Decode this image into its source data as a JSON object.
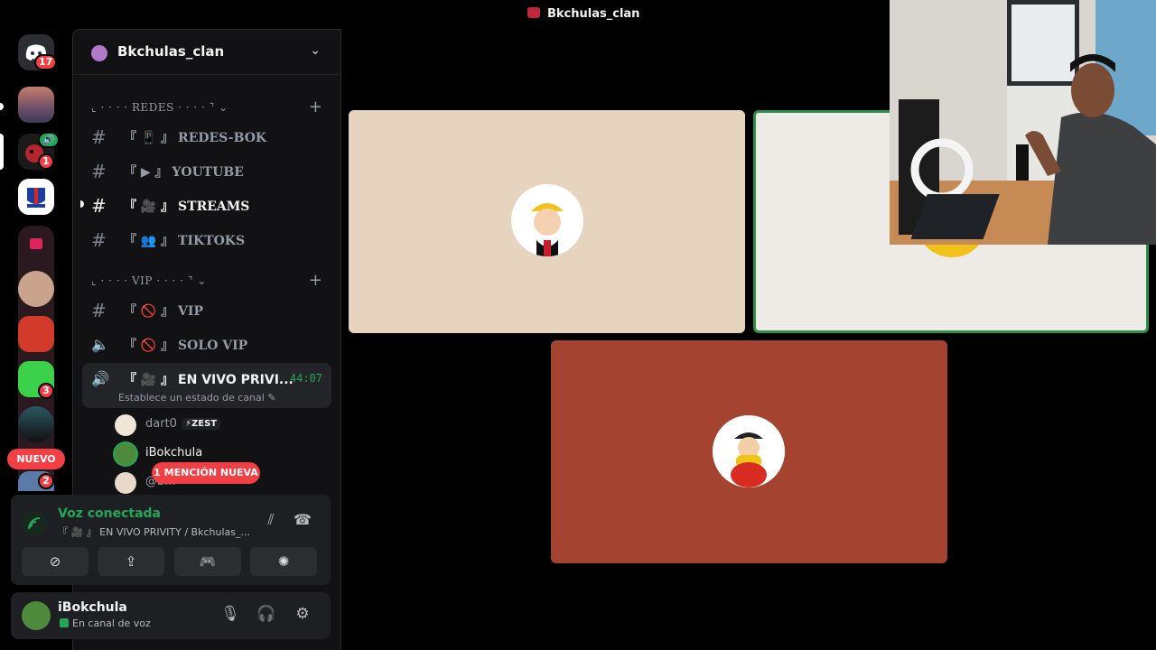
{
  "window": {
    "title": "Bkchulas_clan"
  },
  "rail": {
    "home_badge": "17",
    "server_badges": {
      "dm_badge": "1",
      "server3_badge": "3",
      "server_last_badge": "2"
    },
    "new_label": "NUEVO"
  },
  "server": {
    "name": "Bkchulas_clan",
    "categories": [
      {
        "label": "⌞ · · · · REDES · · · · ⌝ ⌄"
      },
      {
        "label": "⌞ · · · · VIP · · · · ⌝ ⌄"
      }
    ],
    "channels": [
      {
        "label": "『 📱 』 REDES-BOK"
      },
      {
        "label": "『 ▶ 』 YOUTUBE"
      },
      {
        "label": "『 🎥 』 STREAMS"
      },
      {
        "label": "『 👥 』 TIKTOKS"
      },
      {
        "label": "『 🚫 』 VIP"
      },
      {
        "label": "『 🚫 』 SOLO VIP"
      },
      {
        "label": "『 🎥 』 EN VIVO PRIVI...",
        "timer": "44:07",
        "status": "Establece un estado de canal ✎"
      }
    ],
    "members": [
      {
        "name": "dart0",
        "tag": "⚡ZEST"
      },
      {
        "name": "iBokchula"
      },
      {
        "name": "@b..."
      }
    ],
    "mention_label": "1 MENCIÓN NUEVA"
  },
  "voice": {
    "title": "Voz conectada",
    "subtitle": "『 🎥 』 EN VIVO PRIVITY / Bkchulas_..."
  },
  "user": {
    "name": "iBokchula",
    "status": "En canal de voz"
  },
  "colors": {
    "tile1": "#e6d4bf",
    "tile2": "#eeebe7",
    "tile3": "#a34330",
    "speaking_border": "#2f8f4a",
    "green": "#23a55a",
    "red": "#f23f43"
  }
}
